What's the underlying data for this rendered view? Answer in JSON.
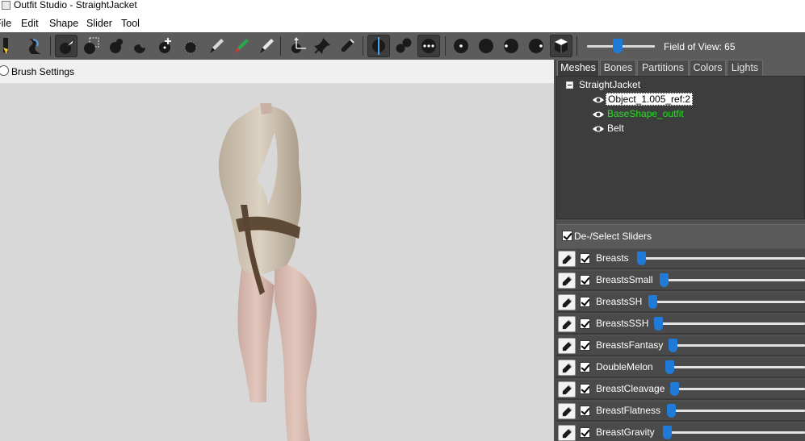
{
  "window": {
    "title": "Outfit Studio - StraightJacket"
  },
  "menu": [
    "File",
    "Edit",
    "Shape",
    "Slider",
    "Tool"
  ],
  "toolbar": {
    "fov_label": "Field of View: 65",
    "fov_value": 65
  },
  "brush": {
    "label": "Brush Settings"
  },
  "tabs": [
    {
      "label": "Meshes",
      "active": true
    },
    {
      "label": "Bones",
      "active": false
    },
    {
      "label": "Partitions",
      "active": false
    },
    {
      "label": "Colors",
      "active": false
    },
    {
      "label": "Lights",
      "active": false
    }
  ],
  "meshes": {
    "root": "StraightJacket",
    "items": [
      {
        "label": "Object_1.005_ref:2",
        "state": "selected"
      },
      {
        "label": "BaseShape_outfit",
        "state": "reference"
      },
      {
        "label": "Belt",
        "state": "normal"
      }
    ]
  },
  "sliders": {
    "header": "De-/Select Sliders",
    "items": [
      {
        "name": "Breasts",
        "checked": true,
        "value": 0.0
      },
      {
        "name": "BreastsSmall",
        "checked": true,
        "value": 0.0
      },
      {
        "name": "BreastsSH",
        "checked": true,
        "value": 0.0
      },
      {
        "name": "BreastsSSH",
        "checked": true,
        "value": 0.0
      },
      {
        "name": "BreastsFantasy",
        "checked": true,
        "value": 0.0
      },
      {
        "name": "DoubleMelon",
        "checked": true,
        "value": 0.0
      },
      {
        "name": "BreastCleavage",
        "checked": true,
        "value": 0.0
      },
      {
        "name": "BreastFlatness",
        "checked": true,
        "value": 0.0
      },
      {
        "name": "BreastGravity",
        "checked": true,
        "value": 0.0
      }
    ]
  },
  "colors": {
    "toolbar_bg": "#5c5c5c",
    "panel_bg": "#3d3d3d",
    "accent": "#1f7ad8",
    "reference_text": "#21e121",
    "viewport_bg": "#d8d8d8"
  }
}
